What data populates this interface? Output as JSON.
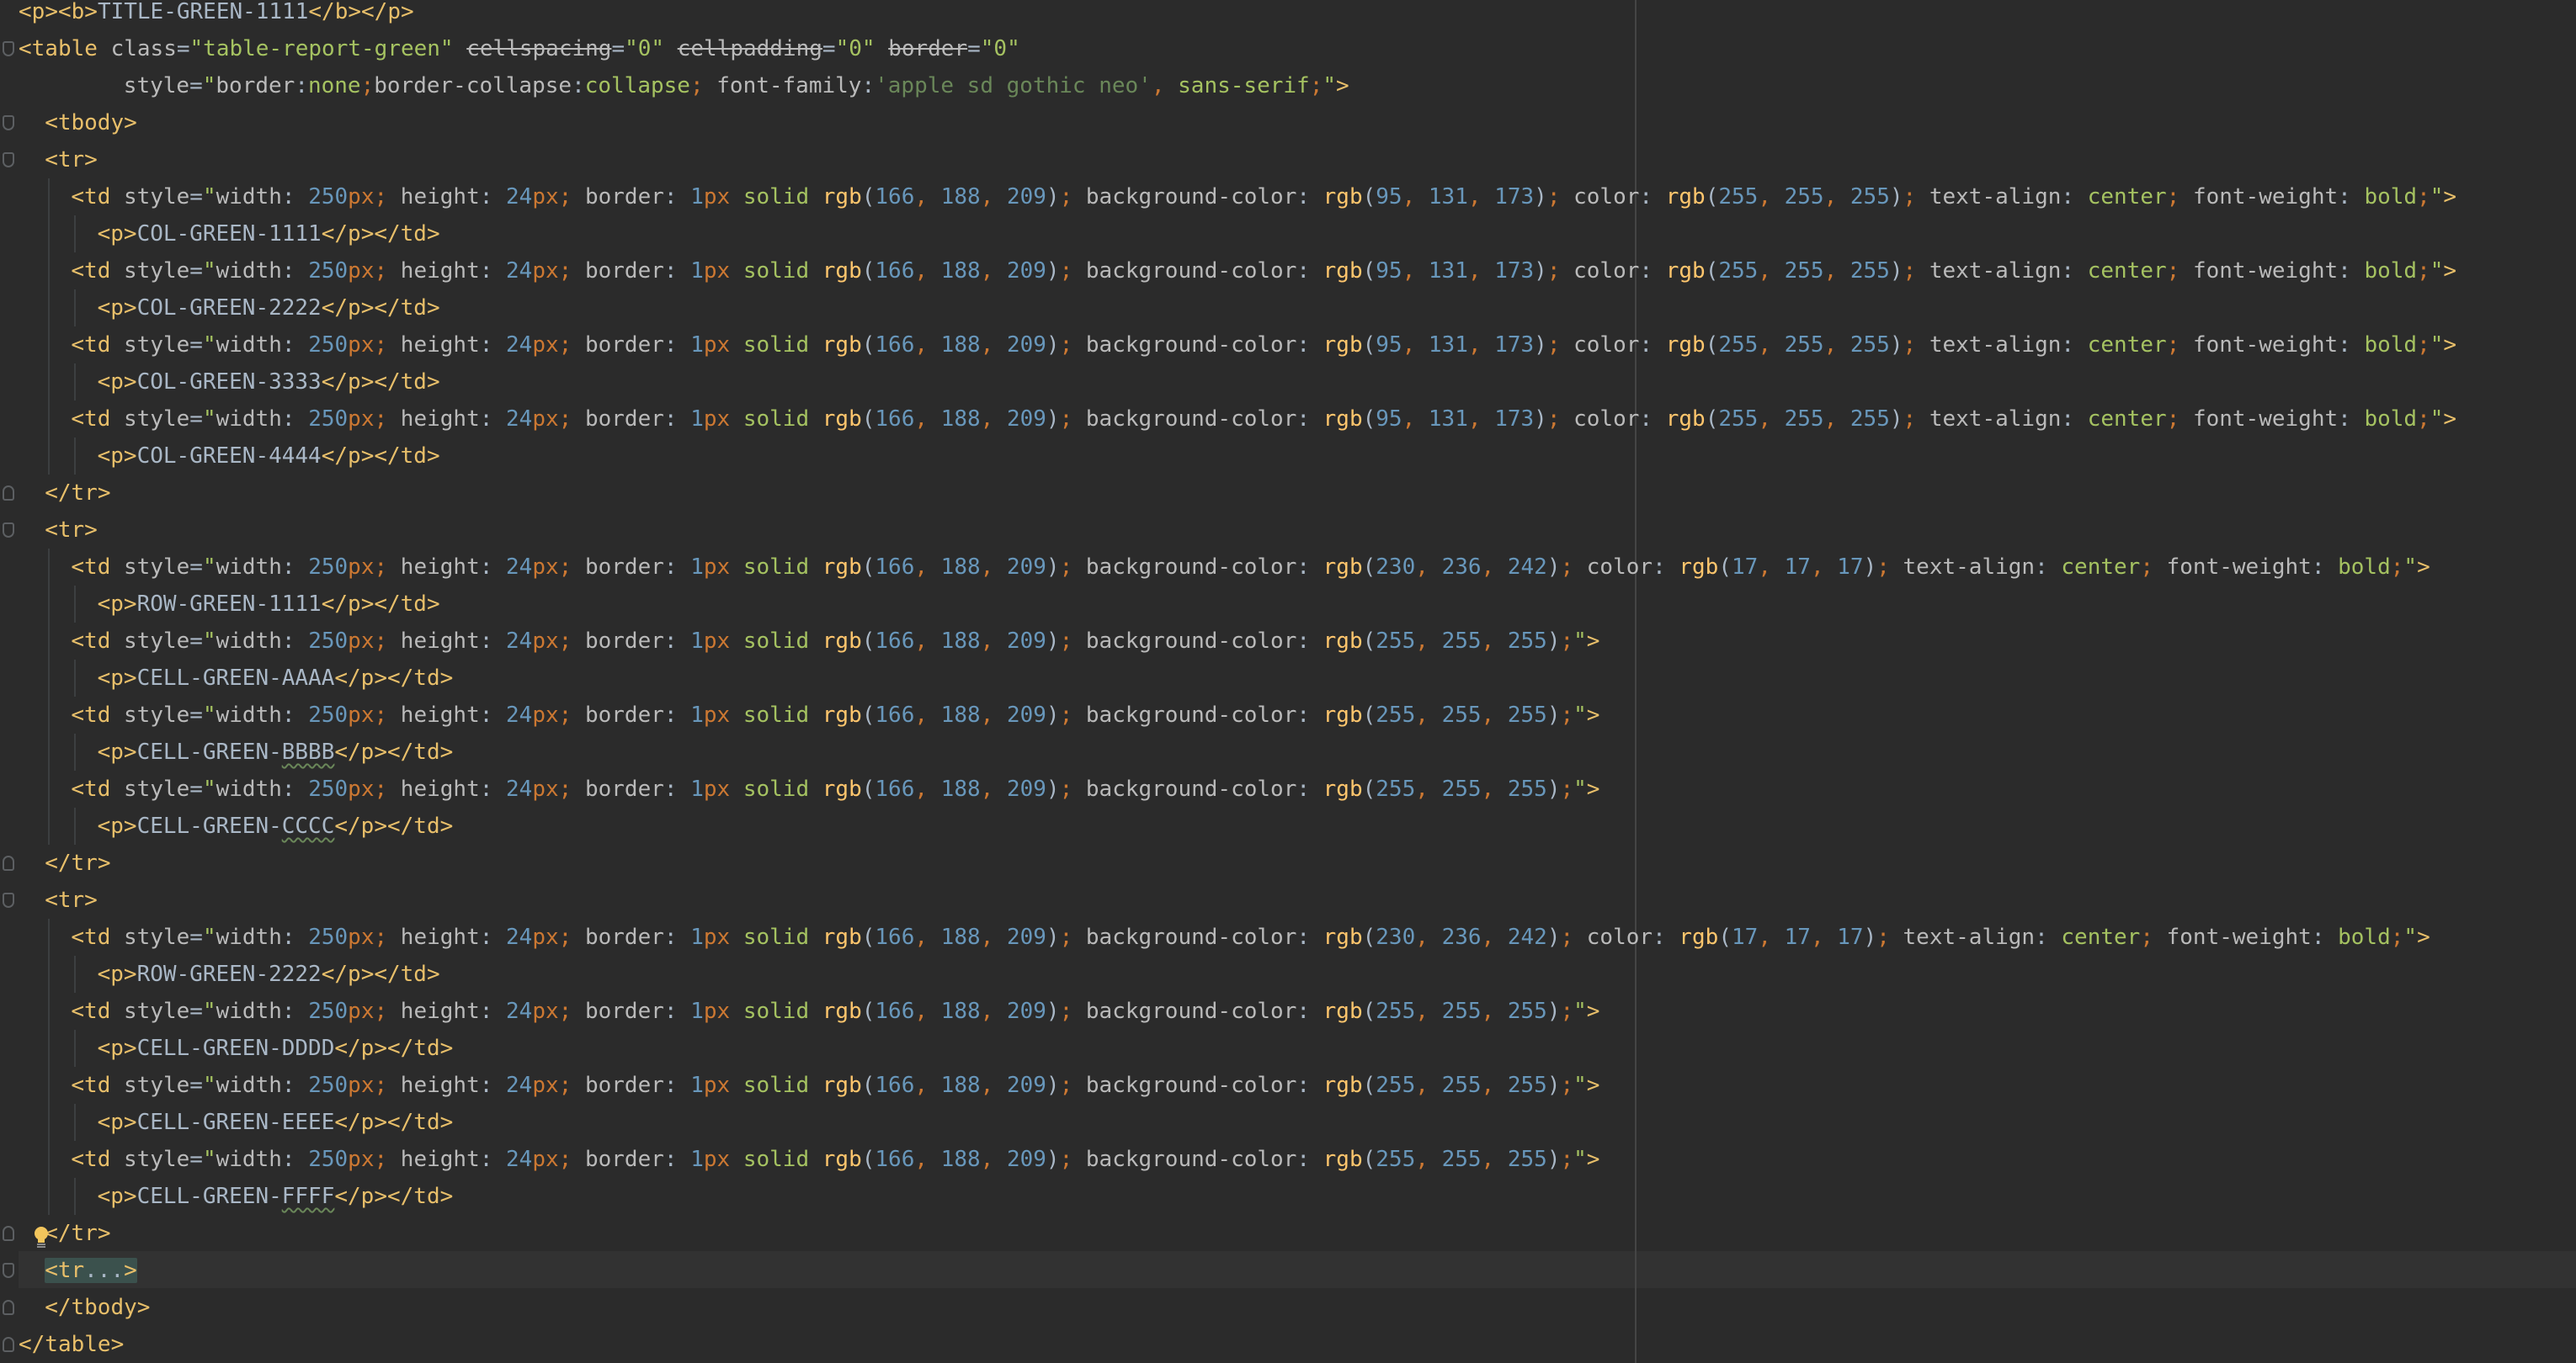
{
  "editor": {
    "lines": [
      "<p><b>TITLE-GREEN-1111</b></p>",
      "<table class=\"table-report-green\" cellspacing=\"0\" cellpadding=\"0\" border=\"0\"",
      "style=\"border:none;border-collapse:collapse; font-family:'apple sd gothic neo', sans-serif;\">",
      "<tbody>",
      "<tr>",
      "<td style=\"width: 250px; height: 24px; border: 1px solid rgb(166, 188, 209); background-color: rgb(95, 131, 173); color: rgb(255, 255, 255); text-align: center; font-weight: bold;\">",
      "<p>COL-GREEN-1111</p></td>",
      "<td style=\"width: 250px; height: 24px; border: 1px solid rgb(166, 188, 209); background-color: rgb(95, 131, 173); color: rgb(255, 255, 255); text-align: center; font-weight: bold;\">",
      "<p>COL-GREEN-2222</p></td>",
      "<td style=\"width: 250px; height: 24px; border: 1px solid rgb(166, 188, 209); background-color: rgb(95, 131, 173); color: rgb(255, 255, 255); text-align: center; font-weight: bold;\">",
      "<p>COL-GREEN-3333</p></td>",
      "<td style=\"width: 250px; height: 24px; border: 1px solid rgb(166, 188, 209); background-color: rgb(95, 131, 173); color: rgb(255, 255, 255); text-align: center; font-weight: bold;\">",
      "<p>COL-GREEN-4444</p></td>",
      "</tr>",
      "<tr>",
      "<td style=\"width: 250px; height: 24px; border: 1px solid rgb(166, 188, 209); background-color: rgb(230, 236, 242); color: rgb(17, 17, 17); text-align: center; font-weight: bold;\">",
      "<p>ROW-GREEN-1111</p></td>",
      "<td style=\"width: 250px; height: 24px; border: 1px solid rgb(166, 188, 209); background-color: rgb(255, 255, 255);\">",
      "<p>CELL-GREEN-AAAA</p></td>",
      "<td style=\"width: 250px; height: 24px; border: 1px solid rgb(166, 188, 209); background-color: rgb(255, 255, 255);\">",
      "<p>CELL-GREEN-BBBB</p></td>",
      "<td style=\"width: 250px; height: 24px; border: 1px solid rgb(166, 188, 209); background-color: rgb(255, 255, 255);\">",
      "<p>CELL-GREEN-CCCC</p></td>",
      "</tr>",
      "<tr>",
      "<td style=\"width: 250px; height: 24px; border: 1px solid rgb(166, 188, 209); background-color: rgb(230, 236, 242); color: rgb(17, 17, 17); text-align: center; font-weight: bold;\">",
      "<p>ROW-GREEN-2222</p></td>",
      "<td style=\"width: 250px; height: 24px; border: 1px solid rgb(166, 188, 209); background-color: rgb(255, 255, 255);\">",
      "<p>CELL-GREEN-DDDD</p></td>",
      "<td style=\"width: 250px; height: 24px; border: 1px solid rgb(166, 188, 209); background-color: rgb(255, 255, 255);\">",
      "<p>CELL-GREEN-EEEE</p></td>",
      "<td style=\"width: 250px; height: 24px; border: 1px solid rgb(166, 188, 209); background-color: rgb(255, 255, 255);\">",
      "<p>CELL-GREEN-FFFF</p></td>",
      "</tr>",
      "<tr...>",
      "</tbody>",
      "</table>"
    ],
    "indents": [
      0,
      0,
      4,
      1,
      1,
      2,
      3,
      2,
      3,
      2,
      3,
      2,
      3,
      1,
      1,
      2,
      3,
      2,
      3,
      2,
      3,
      2,
      3,
      1,
      1,
      2,
      3,
      2,
      3,
      2,
      3,
      2,
      3,
      1,
      1,
      1,
      0
    ],
    "current_line_index": 34,
    "colors": {
      "background": "#2b2b2b",
      "tag": "#e8bf6a",
      "attribute": "#bababa",
      "attribute_value": "#a5c261",
      "string": "#6a8759",
      "number": "#6897bb",
      "function": "#ffc66d",
      "punctuation": "#cc7832",
      "text": "#a9b7c6",
      "current_line": "#323232",
      "folded_region": "#3b514d"
    },
    "icons": {
      "fold_marker": "fold-marker-icon",
      "intention_bulb": "lightbulb-icon"
    }
  }
}
